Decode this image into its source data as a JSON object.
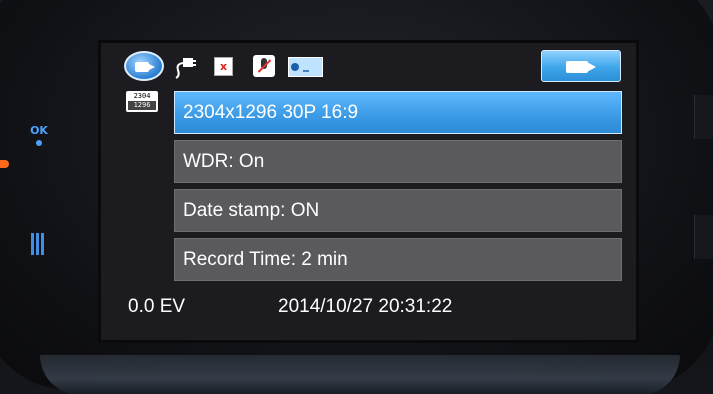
{
  "side_buttons": {
    "ok_label": "OK"
  },
  "status_icons": {
    "mode": "video-mode-icon",
    "power": "plug-icon",
    "sd_card": "sd-card-icon",
    "sd_mark": "x",
    "microphone": "mic-muted-icon",
    "motion": "motion-detect-icon",
    "record_mode": "camcorder-icon"
  },
  "resolution_badge": {
    "top": "2304",
    "bottom": "1296"
  },
  "menu": {
    "items": [
      {
        "label": "2304x1296 30P 16:9",
        "selected": true
      },
      {
        "label": "WDR: On",
        "selected": false
      },
      {
        "label": "Date stamp: ON",
        "selected": false
      },
      {
        "label": "Record Time: 2 min",
        "selected": false
      }
    ]
  },
  "status_bar": {
    "exposure": "0.0 EV",
    "datetime": "2014/10/27 20:31:22"
  },
  "colors": {
    "highlight": "#3a9ae5",
    "row_bg": "#5a5a5e",
    "screen_bg": "#1c1c20",
    "button_accent": "#4aa3ff"
  }
}
